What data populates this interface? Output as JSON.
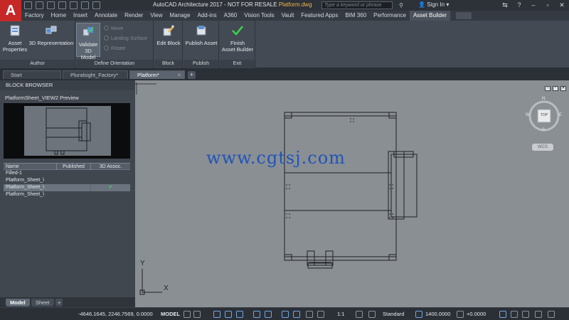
{
  "titlebar": {
    "logo": "A",
    "app_title": "AutoCAD Architecture 2017 - NOT FOR RESALE",
    "file_title": "Platform.dwg",
    "search_placeholder": "Type a keyword or phrase",
    "sign_in": "Sign In"
  },
  "ribbon_tabs": [
    "Factory",
    "Home",
    "Insert",
    "Annotate",
    "Render",
    "View",
    "Manage",
    "Add-ins",
    "A360",
    "Vision Tools",
    "Vault",
    "Featured Apps",
    "BIM 360",
    "Performance",
    "Asset Builder"
  ],
  "active_ribbon_tab": "Asset Builder",
  "ribbon": {
    "author_panel": "Author",
    "asset_properties": "Asset\nProperties",
    "representation_3d": "3D Representation",
    "orientation_panel": "Define Orientation",
    "validate_model": "Validate\n3D Model",
    "move": "Move",
    "landing_surface": "Landing Surface",
    "rotate": "Rotate",
    "block_panel": "Block",
    "edit_block": "Edit Block",
    "publish_panel": "Publish",
    "publish_asset": "Publish Asset",
    "exit_panel": "Exit",
    "finish_builder": "Finish\nAsset Builder"
  },
  "file_tabs": [
    "Start",
    "Pluralsight_Factory*",
    "Platform*"
  ],
  "block_browser": {
    "title": "BLOCK BROWSER",
    "preview_label": "PlatformSheet_VIEW2 Preview",
    "columns": [
      "Name",
      "Published",
      "3D Assoc."
    ],
    "rows": [
      {
        "name": "Filled-1",
        "published": "",
        "assoc": ""
      },
      {
        "name": "Platform_Sheet_\\",
        "published": "",
        "assoc": ""
      },
      {
        "name": "Platform_Sheet_\\",
        "published": "",
        "assoc": "✔"
      },
      {
        "name": "Platform_Sheet_\\",
        "published": "",
        "assoc": ""
      }
    ],
    "selected_row": 2
  },
  "model_tabs": [
    "Model",
    "Sheet"
  ],
  "canvas": {
    "viewcube_top": "TOP",
    "compass": {
      "n": "N",
      "s": "S",
      "e": "E",
      "w": "W"
    },
    "wcs": "WCS",
    "watermark": "www.cgtsj.com",
    "ucs_x": "X",
    "ucs_y": "Y"
  },
  "statusbar": {
    "coordinates": "-4646.1645, 2246.7569, 0.0000",
    "model": "MODEL",
    "scale": "1:1",
    "style": "Standard",
    "elevation": "1400.0000",
    "offset": "+0.0000"
  },
  "colors": {
    "accent": "#c62828",
    "canvas": "#8a8f94",
    "check": "#3fd04f",
    "watermark": "#1f55b8"
  }
}
